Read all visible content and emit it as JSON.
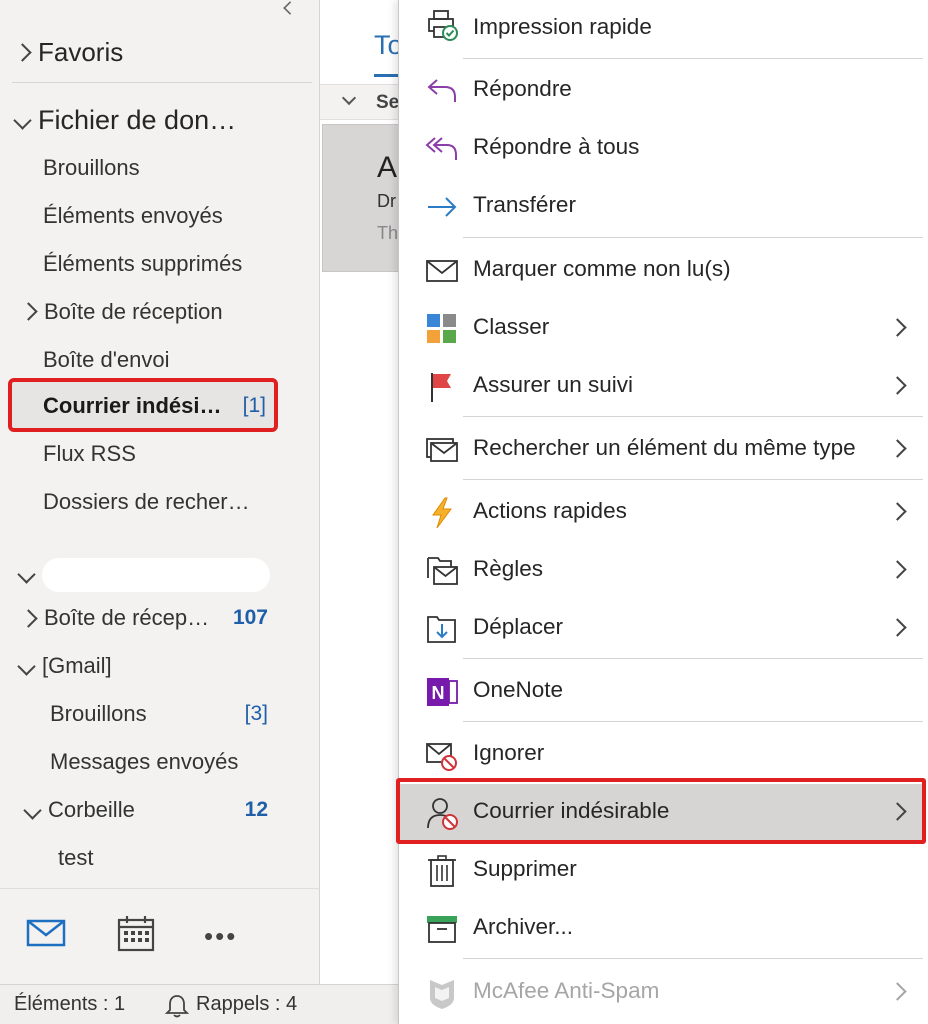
{
  "folder_pane": {
    "favorites_label": "Favoris",
    "data_file": {
      "label": "Fichier de don…",
      "folders": [
        {
          "label": "Brouillons",
          "count": ""
        },
        {
          "label": "Éléments envoyés",
          "count": ""
        },
        {
          "label": "Éléments supprimés",
          "count": ""
        },
        {
          "label": "Boîte de réception",
          "count": ""
        },
        {
          "label": "Boîte d'envoi",
          "count": ""
        },
        {
          "label": "Courrier indési…",
          "count": "[1]"
        },
        {
          "label": "Flux RSS",
          "count": ""
        },
        {
          "label": "Dossiers de recher…",
          "count": ""
        }
      ]
    },
    "account": {
      "folders": [
        {
          "label": "Boîte de récep…",
          "count": "107"
        },
        {
          "label": "[Gmail]",
          "count": ""
        },
        {
          "label": "Brouillons",
          "count": "[3]"
        },
        {
          "label": "Messages envoyés",
          "count": ""
        },
        {
          "label": "Corbeille",
          "count": "12"
        },
        {
          "label": "test",
          "count": ""
        }
      ]
    }
  },
  "bottom_nav": {
    "more_label": "•••"
  },
  "status_bar": {
    "items_label": "Éléments : 1",
    "reminders_label": "Rappels : 4"
  },
  "message_list": {
    "tab_peek": "To",
    "group_peek": "Se",
    "card": {
      "sender_peek": "A",
      "from_peek": "Dr",
      "preview_peek": "Th"
    }
  },
  "context_menu": {
    "items": [
      {
        "label": "Impression rapide",
        "icon": "quick-print-icon"
      },
      {
        "label": "Répondre",
        "icon": "reply-icon"
      },
      {
        "label": "Répondre à tous",
        "icon": "reply-all-icon"
      },
      {
        "label": "Transférer",
        "icon": "forward-icon"
      },
      {
        "label": "Marquer comme non lu(s)",
        "icon": "envelope-icon"
      },
      {
        "label": "Classer",
        "icon": "categorize-icon"
      },
      {
        "label": "Assurer un suivi",
        "icon": "flag-icon"
      },
      {
        "label": "Rechercher un élément du même type",
        "icon": "find-related-icon"
      },
      {
        "label": "Actions rapides",
        "icon": "lightning-icon"
      },
      {
        "label": "Règles",
        "icon": "rules-icon"
      },
      {
        "label": "Déplacer",
        "icon": "move-icon"
      },
      {
        "label": "OneNote",
        "icon": "onenote-icon"
      },
      {
        "label": "Ignorer",
        "icon": "ignore-icon"
      },
      {
        "label": "Courrier indésirable",
        "icon": "junk-icon"
      },
      {
        "label": "Supprimer",
        "icon": "trash-icon"
      },
      {
        "label": "Archiver...",
        "icon": "archive-icon"
      },
      {
        "label": "McAfee Anti-Spam",
        "icon": "mcafee-icon"
      }
    ]
  },
  "colors": {
    "accent": "#2a6fb3",
    "highlight_red": "#e02020"
  }
}
